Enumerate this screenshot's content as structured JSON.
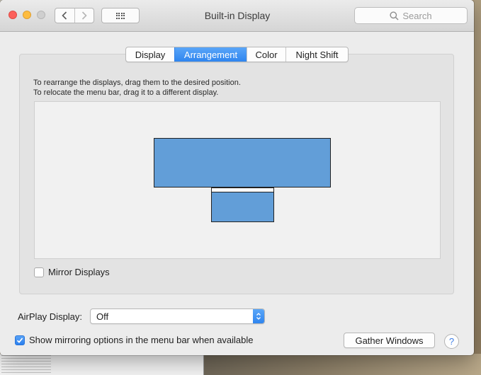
{
  "window": {
    "title": "Built-in Display"
  },
  "toolbar": {
    "back_label": "‹",
    "forward_label": "›",
    "search_placeholder": "Search"
  },
  "tabs": [
    {
      "label": "Display",
      "active": false
    },
    {
      "label": "Arrangement",
      "active": true
    },
    {
      "label": "Color",
      "active": false
    },
    {
      "label": "Night Shift",
      "active": false
    }
  ],
  "arrangement": {
    "instruction_line1": "To rearrange the displays, drag them to the desired position.",
    "instruction_line2": "To relocate the menu bar, drag it to a different display.",
    "mirror_label": "Mirror Displays",
    "mirror_checked": false
  },
  "airplay": {
    "label": "AirPlay Display:",
    "value": "Off"
  },
  "mirroring_option": {
    "label": "Show mirroring options in the menu bar when available",
    "checked": true
  },
  "buttons": {
    "gather_windows": "Gather Windows",
    "help": "?"
  },
  "colors": {
    "accent": "#2f85ef",
    "display_fill": "#629ed8",
    "close": "#fc605b",
    "minimize": "#fdbc40"
  }
}
